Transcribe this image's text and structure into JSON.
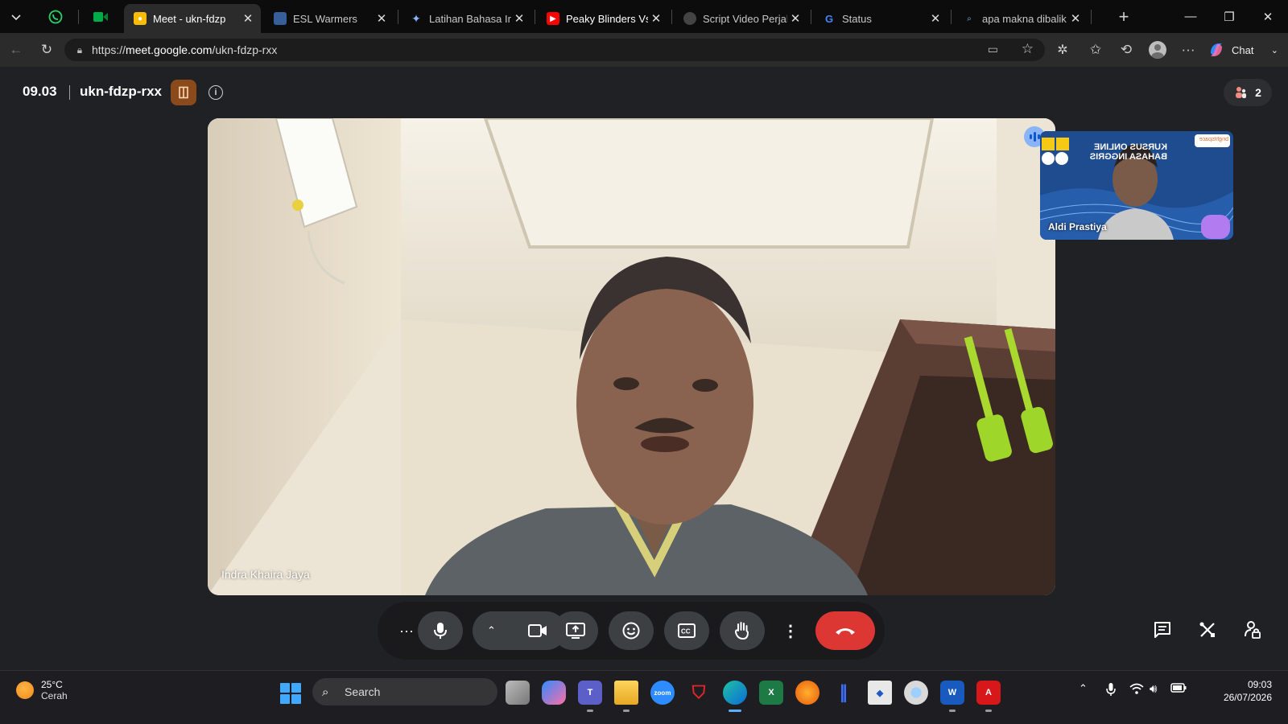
{
  "browser": {
    "tabs": [
      {
        "title": "Meet - ukn-fdzp",
        "favicon": "google-meet-icon",
        "active": true
      },
      {
        "title": "ESL Warmers",
        "favicon": "esl-warmers-icon",
        "active": false
      },
      {
        "title": "Latihan Bahasa Ingg",
        "favicon": "gemini-icon",
        "active": false
      },
      {
        "title": "Peaky Blinders Vs Th",
        "favicon": "youtube-icon",
        "active": false
      },
      {
        "title": "Script Video Perjalan",
        "favicon": "chatgpt-icon",
        "active": false
      },
      {
        "title": "Status",
        "favicon": "google-g-icon",
        "active": false
      },
      {
        "title": "apa makna dibalik ic",
        "favicon": "search-icon",
        "active": false
      }
    ],
    "url_prefix": "https://",
    "url_host": "meet.google.com",
    "url_path": "/ukn-fdzp-rxx",
    "chat_label": "Chat"
  },
  "meet": {
    "time": "09.03",
    "meeting_code": "ukn-fdzp-rxx",
    "participant_count": "2",
    "main_participant": "Indra Khaira Jaya",
    "self_participant": "Aldi Prastiya",
    "self_background_text": "KURSUS ONLINE BAHASA INGGRIS",
    "self_background_brand": "brightspace"
  },
  "controls": [
    {
      "name": "more-actions-button",
      "icon": "ellipsis-icon"
    },
    {
      "name": "microphone-button",
      "icon": "microphone-icon"
    },
    {
      "name": "camera-options-button",
      "icon": "chevron-up-icon"
    },
    {
      "name": "camera-button",
      "icon": "video-camera-icon"
    },
    {
      "name": "present-screen-button",
      "icon": "present-icon"
    },
    {
      "name": "reactions-button",
      "icon": "smiley-icon"
    },
    {
      "name": "captions-button",
      "icon": "captions-icon"
    },
    {
      "name": "raise-hand-button",
      "icon": "hand-icon"
    },
    {
      "name": "more-options-button",
      "icon": "vertical-dots-icon"
    },
    {
      "name": "leave-call-button",
      "icon": "phone-hangup-icon",
      "color": "#dc3733"
    }
  ],
  "side_controls": [
    {
      "name": "chat-button",
      "icon": "chat-icon"
    },
    {
      "name": "activities-button",
      "icon": "tools-icon"
    },
    {
      "name": "host-controls-button",
      "icon": "lock-person-icon"
    }
  ],
  "taskbar": {
    "weather_temp": "25°C",
    "weather_condition": "Cerah",
    "search_label": "Search",
    "clock_time": "09:03",
    "clock_date": "26/07/2026",
    "apps": [
      "file-explorer-task-view-icon",
      "copilot-icon",
      "teams-icon",
      "file-explorer-icon",
      "zoom-icon",
      "mcafee-icon",
      "edge-icon",
      "excel-icon",
      "firefox-icon",
      "notepad-icon",
      "snipping-icon",
      "chrome-icon",
      "word-icon",
      "acrobat-icon"
    ]
  },
  "colors": {
    "meet_background": "#202124",
    "leave_red": "#dc3733",
    "host_badge": "#8a4a1c"
  }
}
